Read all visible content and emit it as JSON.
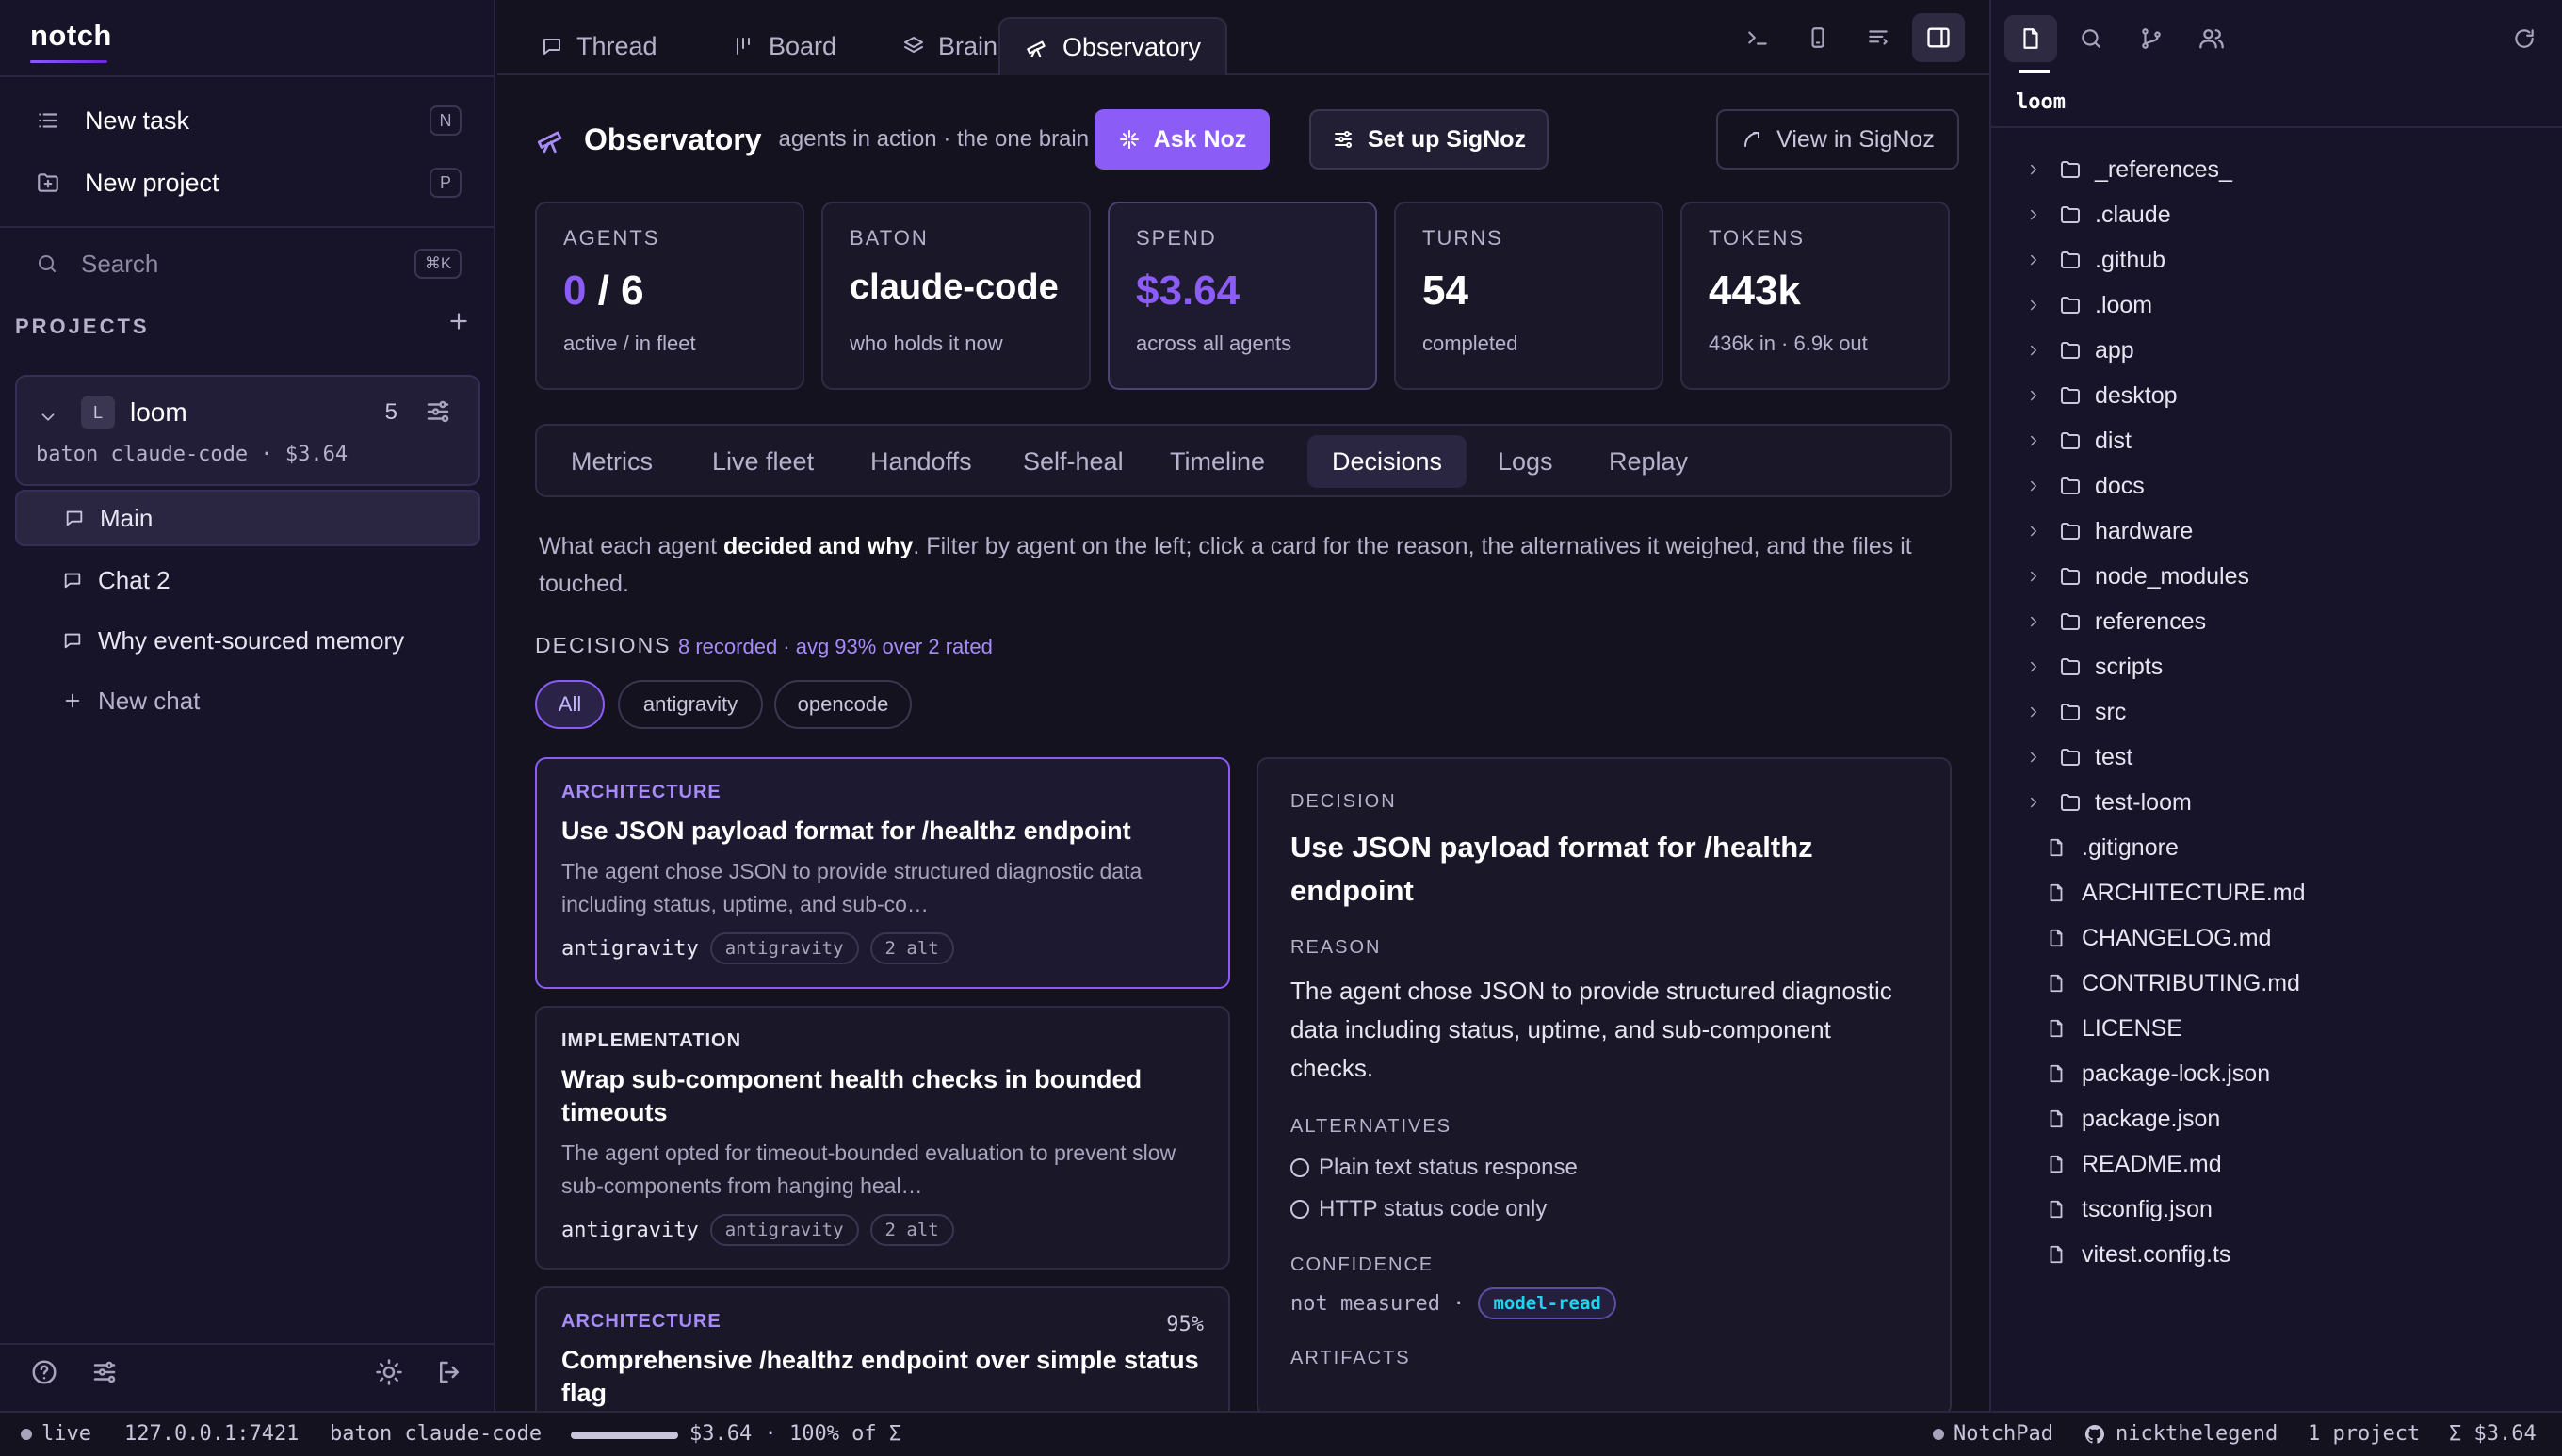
{
  "app": {
    "brand": "notch"
  },
  "sidebar": {
    "new_task": {
      "label": "New task",
      "shortcut": "N"
    },
    "new_project": {
      "label": "New project",
      "shortcut": "P"
    },
    "search": {
      "placeholder": "Search",
      "shortcut": "⌘K"
    },
    "projects_heading": "PROJECTS",
    "project": {
      "badge": "L",
      "name": "loom",
      "count": "5",
      "meta": "baton claude-code · $3.64"
    },
    "chats": [
      "Main",
      "Chat 2",
      "Why event-sourced memory"
    ],
    "new_chat": "New chat"
  },
  "tabs": [
    {
      "label": "Thread",
      "icon": "message-icon"
    },
    {
      "label": "Board",
      "icon": "board-icon"
    },
    {
      "label": "Brain",
      "icon": "layers-icon"
    },
    {
      "label": "Observatory",
      "icon": "telescope-icon",
      "active": true
    }
  ],
  "observatory": {
    "title": "Observatory",
    "subtitle": "agents in action · the one brain",
    "ask_noz": "Ask Noz",
    "setup_signoz": "Set up SigNoz",
    "view_signoz": "View in SigNoz",
    "stats": [
      {
        "label": "AGENTS",
        "value_active": "0",
        "value_total": "/ 6",
        "sub": "active / in fleet"
      },
      {
        "label": "BATON",
        "value": "claude-code",
        "sub": "who holds it now"
      },
      {
        "label": "SPEND",
        "value": "$3.64",
        "sub": "across all agents"
      },
      {
        "label": "TURNS",
        "value": "54",
        "sub": "completed"
      },
      {
        "label": "TOKENS",
        "value": "443k",
        "sub": "436k in · 6.9k out"
      }
    ],
    "subtabs": [
      "Metrics",
      "Live fleet",
      "Handoffs",
      "Self-heal",
      "Timeline",
      "Decisions",
      "Logs",
      "Replay"
    ],
    "active_subtab": "Decisions",
    "intro_before": "What each agent ",
    "intro_bold": "decided and why",
    "intro_after": ". Filter by agent on the left; click a card for the reason, the alternatives it weighed, and the files it touched.",
    "decisions_heading": "DECISIONS",
    "decisions_meta": "8 recorded · avg 93% over 2 rated",
    "filters": [
      "All",
      "antigravity",
      "opencode"
    ],
    "cards": [
      {
        "category": "ARCHITECTURE",
        "title": "Use JSON payload format for /healthz endpoint",
        "desc": "The agent chose JSON to provide structured diagnostic data including status, uptime, and sub-co…",
        "agent": "antigravity",
        "tag": "antigravity",
        "alts": "2 alt"
      },
      {
        "category": "IMPLEMENTATION",
        "title": "Wrap sub-component health checks in bounded timeouts",
        "desc": "The agent opted for timeout-bounded evaluation to prevent slow sub-components from hanging heal…",
        "agent": "antigravity",
        "tag": "antigravity",
        "alts": "2 alt"
      },
      {
        "category": "ARCHITECTURE",
        "pct": "95%",
        "title": "Comprehensive /healthz endpoint over simple status flag"
      }
    ],
    "detail": {
      "decision_label": "DECISION",
      "title": "Use JSON payload format for /healthz endpoint",
      "reason_label": "REASON",
      "reason": "The agent chose JSON to provide structured diagnostic data including status, uptime, and sub-component checks.",
      "alternatives_label": "ALTERNATIVES",
      "alternatives": [
        "Plain text status response",
        "HTTP status code only"
      ],
      "confidence_label": "CONFIDENCE",
      "confidence_text": "not measured ·",
      "confidence_badge": "model-read",
      "artifacts_label": "ARTIFACTS"
    }
  },
  "filetree": {
    "root": "loom",
    "folders": [
      "_references_",
      ".claude",
      ".github",
      ".loom",
      "app",
      "desktop",
      "dist",
      "docs",
      "hardware",
      "node_modules",
      "references",
      "scripts",
      "src",
      "test",
      "test-loom"
    ],
    "files": [
      ".gitignore",
      "ARCHITECTURE.md",
      "CHANGELOG.md",
      "CONTRIBUTING.md",
      "LICENSE",
      "package-lock.json",
      "package.json",
      "README.md",
      "tsconfig.json",
      "vitest.config.ts"
    ]
  },
  "statusbar": {
    "live": "live",
    "address": "127.0.0.1:7421",
    "baton": "baton claude-code",
    "budget_fill": 1.0,
    "budget_text": "$3.64 · 100% of Σ",
    "notchpad": "NotchPad",
    "user": "nickthelegend",
    "projects": "1 project",
    "total": "Σ $3.64"
  },
  "colors": {
    "accent": "#8b5cf6",
    "accent_light": "#a78bfa",
    "badge_cyan": "#22d3ee"
  }
}
